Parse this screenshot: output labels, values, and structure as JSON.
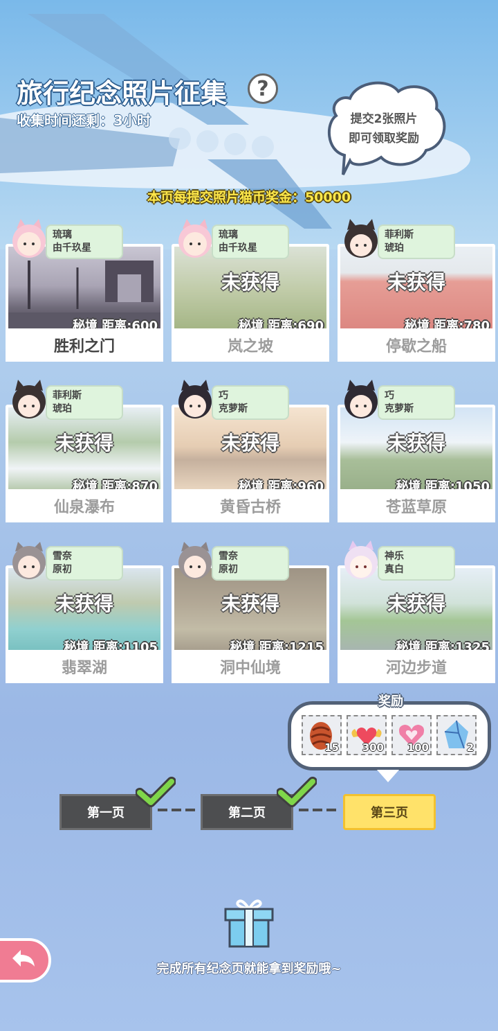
{
  "header": {
    "title": "旅行纪念照片征集",
    "help_glyph": "?",
    "countdown": "收集时间还剩：3小时",
    "tip_line1": "提交2张照片",
    "tip_line2": "即可领取奖励",
    "bonus_text": "本页每提交照片猫币奖金：50000"
  },
  "cards": [
    {
      "char_line1": "琉璃",
      "char_line2": "由千玖星",
      "status": "",
      "distance": "秘境  距离:600",
      "name": "胜利之门"
    },
    {
      "char_line1": "琉璃",
      "char_line2": "由千玖星",
      "status": "未获得",
      "distance": "秘境  距离:690",
      "name": "岚之坡"
    },
    {
      "char_line1": "菲利斯",
      "char_line2": "琥珀",
      "status": "未获得",
      "distance": "秘境  距离:780",
      "name": "停歇之船"
    },
    {
      "char_line1": "菲利斯",
      "char_line2": "琥珀",
      "status": "未获得",
      "distance": "秘境  距离:870",
      "name": "仙泉瀑布"
    },
    {
      "char_line1": "巧",
      "char_line2": "克萝斯",
      "status": "未获得",
      "distance": "秘境  距离:960",
      "name": "黄昏古桥"
    },
    {
      "char_line1": "巧",
      "char_line2": "克萝斯",
      "status": "未获得",
      "distance": "秘境  距离:1050",
      "name": "苍蓝草原"
    },
    {
      "char_line1": "雪奈",
      "char_line2": "原初",
      "status": "未获得",
      "distance": "秘境  距离:1105",
      "name": "翡翠湖"
    },
    {
      "char_line1": "雪奈",
      "char_line2": "原初",
      "status": "未获得",
      "distance": "秘境  距离:1215",
      "name": "洞中仙境"
    },
    {
      "char_line1": "神乐",
      "char_line2": "真白",
      "status": "未获得",
      "distance": "秘境  距离:1325",
      "name": "河边步道"
    }
  ],
  "rewards": {
    "label": "奖励",
    "items": [
      {
        "icon": "pinecone-icon",
        "count": "15"
      },
      {
        "icon": "winged-heart-icon",
        "count": "300"
      },
      {
        "icon": "heart-frame-icon",
        "count": "100"
      },
      {
        "icon": "crystal-icon",
        "count": "2"
      }
    ]
  },
  "pages": {
    "page1": "第一页",
    "page2": "第二页",
    "page3": "第三页"
  },
  "footer": {
    "text": "完成所有纪念页就能拿到奖励哦~"
  },
  "colors": {
    "tag_bg": "#dff4dd",
    "current_page": "#ffe26a",
    "back_button": "#f07c93",
    "bonus_text": "#ffe84a"
  }
}
